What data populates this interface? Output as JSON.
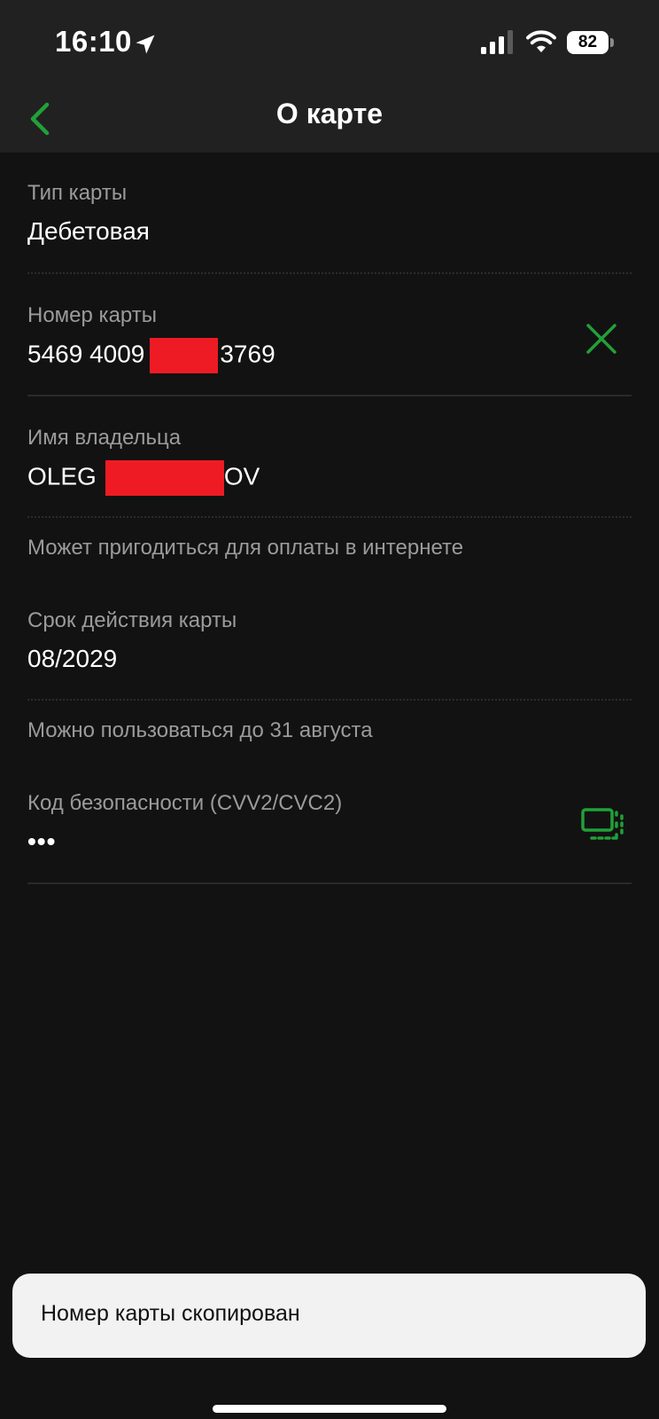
{
  "status_bar": {
    "time": "16:10",
    "battery_level": "82",
    "icons": [
      "location-icon",
      "signal-icon",
      "wifi-icon",
      "battery-icon"
    ]
  },
  "header": {
    "title": "О карте",
    "back_icon": "chevron-left-icon"
  },
  "fields": {
    "card_type": {
      "label": "Тип карты",
      "value": "Дебетовая"
    },
    "card_number": {
      "label": "Номер карты",
      "value_start": "5469 4009",
      "value_end": "3769",
      "action_icon": "close-icon"
    },
    "holder_name": {
      "label": "Имя владельца",
      "value_start": "OLEG",
      "value_end": "OV",
      "hint": "Может пригодиться для оплаты в интернете"
    },
    "expiry": {
      "label": "Срок действия карты",
      "value": "08/2029",
      "hint": "Можно пользоваться до 31 августа"
    },
    "cvv": {
      "label": "Код безопасности (CVV2/CVC2)",
      "value": "•••",
      "action_icon": "copy-icon"
    }
  },
  "toast": {
    "message": "Номер карты скопирован"
  },
  "colors": {
    "background": "#121212",
    "bar_background": "#212121",
    "accent": "#21A038",
    "label": "#9b9b9b",
    "redaction": "#ef1b24",
    "toast_background": "#f2f2f2"
  }
}
